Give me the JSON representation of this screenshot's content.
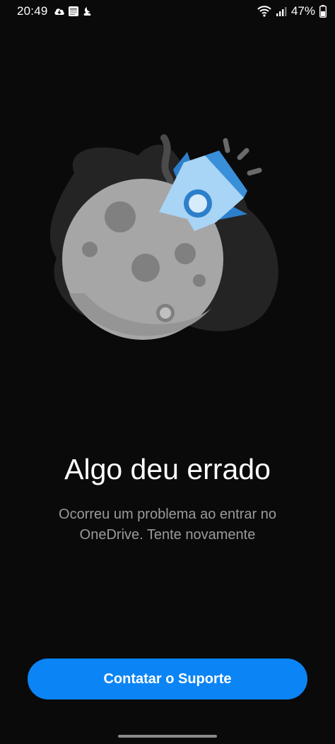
{
  "status_bar": {
    "time": "20:49",
    "battery_percent": "47%",
    "icons_left": [
      "cloud-download-icon",
      "news-app-icon",
      "weather-icon"
    ],
    "icons_right": [
      "wifi-icon",
      "signal-icon",
      "battery-icon"
    ]
  },
  "error": {
    "title": "Algo deu errado",
    "message": "Ocorreu um problema ao entrar no OneDrive. Tente novamente"
  },
  "actions": {
    "support_label": "Contatar o Suporte"
  },
  "colors": {
    "background": "#0a0a0a",
    "accent": "#0b84f5",
    "message_text": "#9a9a9a",
    "moon": "#a6a6a6",
    "rocket": "#3a8fd9"
  }
}
